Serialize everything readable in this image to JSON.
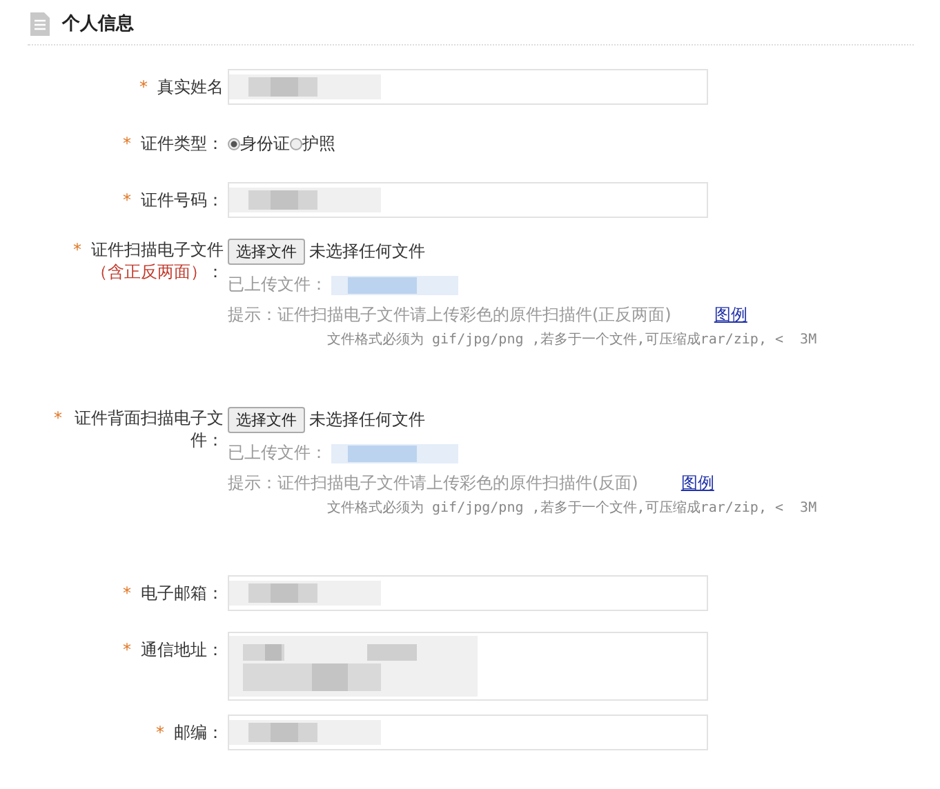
{
  "section": {
    "title": "个人信息"
  },
  "rows": [
    {
      "kind": "text",
      "mark": "*",
      "label": "真实姓名",
      "masked": true
    },
    {
      "kind": "radio",
      "mark": "*",
      "label": "证件类型：",
      "options": [
        {
          "label": "身份证",
          "selected": true
        },
        {
          "label": "护照",
          "selected": false
        }
      ]
    },
    {
      "kind": "text",
      "mark": "*",
      "label": "证件号码：",
      "masked": true
    },
    {
      "kind": "file",
      "mark": "*",
      "label": "证件扫描电子文件",
      "note": "（含正反两面）",
      "colon": "：",
      "button": "选择文件",
      "status": "未选择任何文件",
      "uploaded_label": "已上传文件：",
      "hint": "提示：证件扫描电子文件请上传彩色的原件扫描件(正反两面)",
      "link": "图例",
      "format": "文件格式必须为 gif/jpg/png ,若多于一个文件,可压缩成rar/zip, <  3M"
    },
    {
      "kind": "file",
      "mark": "*",
      "label": "证件背面扫描电子文件：",
      "button": "选择文件",
      "status": "未选择任何文件",
      "uploaded_label": "已上传文件：",
      "hint": "提示：证件扫描电子文件请上传彩色的原件扫描件(反面)",
      "link": "图例",
      "format": "文件格式必须为 gif/jpg/png ,若多于一个文件,可压缩成rar/zip, <  3M"
    },
    {
      "kind": "text",
      "mark": "*",
      "label": "电子邮箱：",
      "masked": true
    },
    {
      "kind": "textarea",
      "mark": "*",
      "label": "通信地址：",
      "masked": true
    },
    {
      "kind": "text",
      "mark": "*",
      "label": "邮编：",
      "masked": true
    }
  ]
}
